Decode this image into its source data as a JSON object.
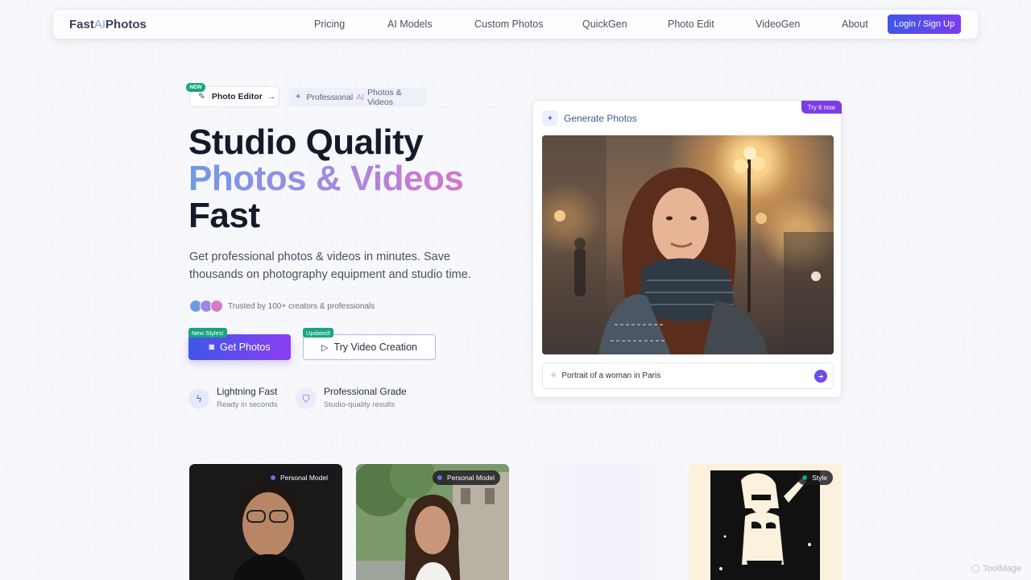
{
  "nav": {
    "logo": {
      "part1": "Fast",
      "part2": "AI",
      "part3": "Photos"
    },
    "links": [
      "Pricing",
      "AI Models",
      "Custom Photos",
      "QuickGen",
      "Photo Edit",
      "VideoGen",
      "About"
    ],
    "login": "Login / Sign Up"
  },
  "hero": {
    "new_badge": "NEW",
    "editor_pill": "Photo Editor",
    "pro_pill": {
      "pre": "Professional",
      "ai": "AI",
      "post": "Photos & Videos"
    },
    "title_line1": "Studio Quality",
    "title_line2": "Photos & Videos",
    "title_line3": "Fast",
    "subtitle": "Get professional photos & videos in minutes. Save thousands on photography equipment and studio time.",
    "trust": "Trusted by 100+ creators & professionals",
    "primary_badge": "New Styles!",
    "primary_button": "Get Photos",
    "secondary_badge": "Updated!",
    "secondary_button": "Try Video Creation",
    "features": [
      {
        "title": "Lightning Fast",
        "sub": "Ready in seconds"
      },
      {
        "title": "Professional Grade",
        "sub": "Studio-quality results"
      }
    ]
  },
  "generator": {
    "tag": "Try it now",
    "title": "Generate Photos",
    "prompt": "Portrait of a woman in Paris"
  },
  "gallery": [
    {
      "tag": "Personal Model",
      "dot": "#6b6fd8"
    },
    {
      "tag": "Personal Model",
      "dot": "#6b6fd8"
    },
    {
      "tag": ""
    },
    {
      "tag": "Style",
      "dot": "#19a47f"
    }
  ],
  "watermark": "ToolMage",
  "colors": {
    "accent": "#4f46e5",
    "accent2": "#8b3ef0",
    "green": "#19a47f"
  }
}
